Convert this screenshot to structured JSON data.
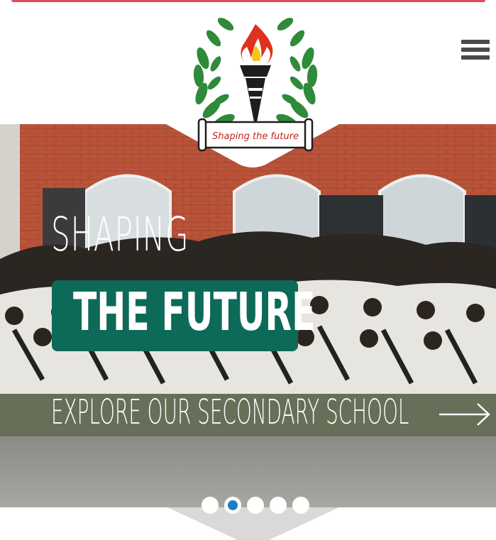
{
  "colors": {
    "top_bar": "#e04a58",
    "menu_icon": "#4a4a4a",
    "hero_text": "#ffffff",
    "hero_box": "#0e6a58",
    "dot_active": "#1d7fc2",
    "notch": "#d9d9d9",
    "brick": "#c0583c",
    "uniform": "#e8e8e2",
    "skirt": "#4a5a3c"
  },
  "header": {
    "logo_icon": "torch-laurel-logo",
    "logo_motto": "Shaping the future",
    "menu_icon": "hamburger-menu-icon"
  },
  "hero": {
    "line1": "SHAPING",
    "line2": "THE FUTURE",
    "cta_label": "EXPLORE OUR SECONDARY SCHOOL",
    "cta_icon": "arrow-right-icon"
  },
  "slider": {
    "slide_count": 5,
    "active_index": 1
  }
}
